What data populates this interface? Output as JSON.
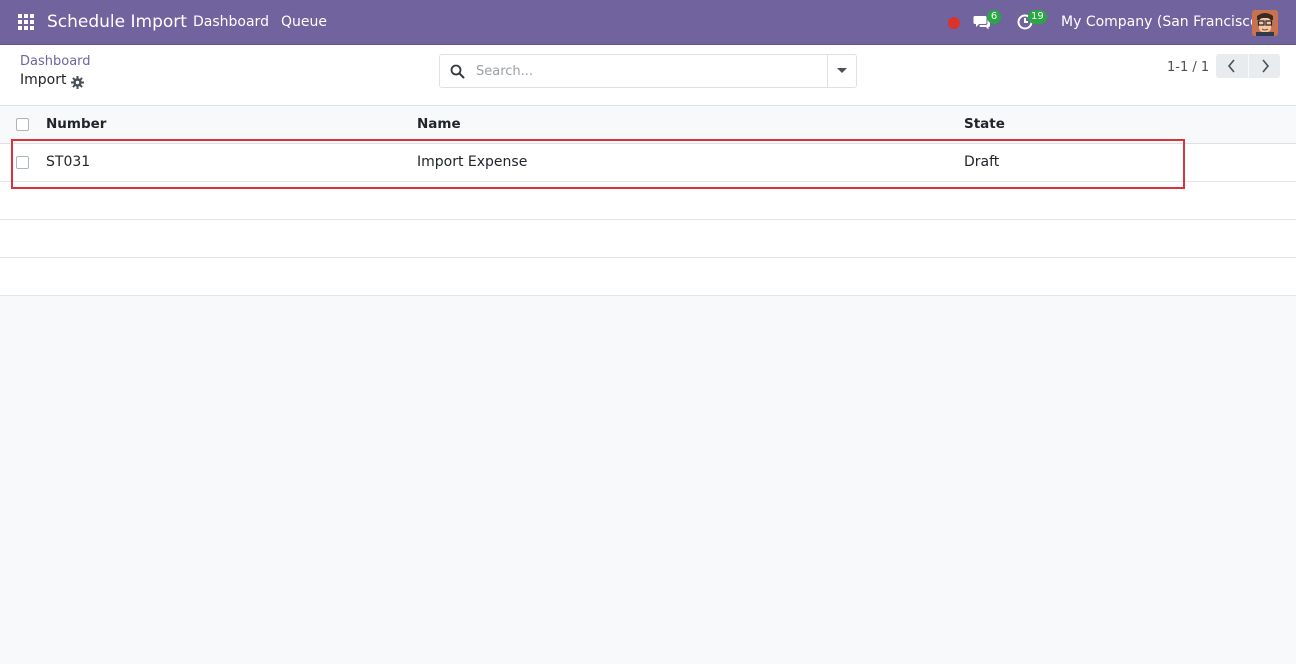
{
  "navbar": {
    "app_title": "Schedule Import",
    "menu": [
      "Dashboard",
      "Queue"
    ],
    "messages_count": "6",
    "activities_count": "19",
    "company": "My Company (San Francisco)",
    "bg_color": "#71639e"
  },
  "breadcrumb": {
    "parent": "Dashboard",
    "current": "Import"
  },
  "search": {
    "placeholder": "Search..."
  },
  "pager": {
    "value": "1-1 / 1"
  },
  "table": {
    "columns": [
      "Number",
      "Name",
      "State"
    ],
    "rows": [
      {
        "number": "ST031",
        "name": "Import Expense",
        "state": "Draft"
      }
    ]
  },
  "icons": {
    "apps": "apps-grid-icon",
    "record": "record-dot-icon",
    "messages": "chat-icon",
    "activities": "clock-icon",
    "gear": "gear-icon",
    "search": "search-icon",
    "caret": "caret-down-icon",
    "prev": "chevron-left-icon",
    "next": "chevron-right-icon"
  }
}
